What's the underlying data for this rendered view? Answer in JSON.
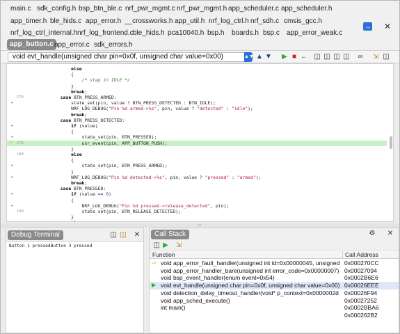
{
  "tabs": {
    "row1": [
      "main.c",
      "sdk_config.h",
      "bsp_btn_ble.c",
      "nrf_pwr_mgmt.c",
      "nrf_pwr_mgmt.h",
      "app_scheduler.c",
      "app_scheduler.h"
    ],
    "row2": [
      "app_timer.h",
      "ble_hids.c",
      "app_error.h",
      "__crossworks.h",
      "app_util.h",
      "nrf_log_ctrl.h",
      "nrf_sdh.c",
      "cmsis_gcc.h"
    ],
    "row3": [
      "nrf_log_ctrl_internal.h",
      "nrf_log_frontend.c",
      "ble_hids.h",
      "pca10040.h",
      "bsp.h",
      "boards.h",
      "bsp.c",
      "app_error_weak.c"
    ],
    "row4": [
      "app_button.c",
      "app_error.c",
      "sdk_errors.h"
    ],
    "active": "app_button.c",
    "nav_icon": "right-arrow-icon",
    "close_icon": "close-icon"
  },
  "function_selector": {
    "value": "void evt_handle(unsigned char pin=0x0f, unsigned char value=0x00)"
  },
  "editor": {
    "lines": [
      {
        "num": "",
        "mark": "",
        "html": "            <span class=\"kw\">else</span>"
      },
      {
        "num": "",
        "mark": "",
        "html": "            {"
      },
      {
        "num": "",
        "mark": "",
        "html": "                <span class=\"cmt\">/* stay in IDLE */</span>"
      },
      {
        "num": "",
        "mark": "",
        "html": "            }"
      },
      {
        "num": "",
        "mark": "",
        "html": "            <span class=\"kw\">break</span>;"
      },
      {
        "num": "170",
        "mark": "",
        "html": "        <span class=\"kw\">case</span> BTN_PRESS_ARMED:"
      },
      {
        "num": "",
        "mark": "bp",
        "html": "            state_set(pin, value ? BTN_PRESS_DETECTED : BTN_IDLE);"
      },
      {
        "num": "",
        "mark": "",
        "html": "            NRF_LOG_DEBUG(<span class=\"str\">\"Pin %d armed->%s\"</span>, pin, value ? <span class=\"str\">\"detected\"</span> : <span class=\"str\">\"idle\"</span>);"
      },
      {
        "num": "",
        "mark": "",
        "html": "            <span class=\"kw\">break</span>;"
      },
      {
        "num": "",
        "mark": "",
        "html": "        <span class=\"kw\">case</span> BTN_PRESS_DETECTED:"
      },
      {
        "num": "",
        "mark": "bp",
        "html": "            <span class=\"kw\">if</span> (value)"
      },
      {
        "num": "",
        "mark": "",
        "html": "            {"
      },
      {
        "num": "",
        "mark": "bp",
        "html": "                state_set(pin, BTN_PRESSED);"
      },
      {
        "num": "178",
        "mark": "cur",
        "hl": true,
        "html": "                usr_event(pin, APP_BUTTON_PUSH);"
      },
      {
        "num": "",
        "mark": "",
        "html": "            }"
      },
      {
        "num": "180",
        "mark": "",
        "html": "            <span class=\"kw\">else</span>"
      },
      {
        "num": "",
        "mark": "",
        "html": "            {"
      },
      {
        "num": "",
        "mark": "bp",
        "html": "                state_set(pin, BTN_PRESS_ARMED);"
      },
      {
        "num": "",
        "mark": "",
        "html": "            }"
      },
      {
        "num": "",
        "mark": "bp",
        "html": "            NRF_LOG_DEBUG(<span class=\"str\">\"Pin %d detected->%s\"</span>, pin, value ? <span class=\"str\">\"pressed\"</span> : <span class=\"str\">\"armed\"</span>);"
      },
      {
        "num": "",
        "mark": "",
        "html": "            <span class=\"kw\">break</span>;"
      },
      {
        "num": "",
        "mark": "",
        "html": "        <span class=\"kw\">case</span> BTN_PRESSED:"
      },
      {
        "num": "",
        "mark": "bp",
        "html": "            <span class=\"kw\">if</span> (value == <span class=\"num\">0</span>)"
      },
      {
        "num": "",
        "mark": "",
        "html": "            {"
      },
      {
        "num": "",
        "mark": "bp",
        "html": "                NRF_LOG_DEBUG(<span class=\"str\">\"Pin %d pressed->release_detected\"</span>, pin);"
      },
      {
        "num": "190",
        "mark": "",
        "html": "                state_set(pin, BTN_RELEASE_DETECTED);"
      },
      {
        "num": "",
        "mark": "",
        "html": "            }"
      },
      {
        "num": "",
        "mark": "",
        "html": "            <span class=\"kw\">else</span>"
      }
    ]
  },
  "debug_terminal": {
    "title": "Debug Terminal",
    "output": "Button 1 pressedButton 3 pressed"
  },
  "call_stack": {
    "title": "Call Stack",
    "col_function": "Function",
    "col_address": "Call Address",
    "rows": [
      {
        "func": "void app_error_fault_handler(unsigned int id=0x00000045, unsigned",
        "addr": "0x000270CC",
        "mark": "arrow"
      },
      {
        "func": "void app_error_handler_bare(unsigned int error_code=0x00000007)",
        "addr": "0x00027094",
        "mark": ""
      },
      {
        "func": "void bsp_event_handler(enum event=0x54)",
        "addr": "0x0002B6E6",
        "mark": ""
      },
      {
        "func": "void evt_handle(unsigned char pin=0x0f, unsigned char value=0x00)",
        "addr": "0x00026EEE",
        "mark": "current"
      },
      {
        "func": "void detection_delay_timeout_handler(void* p_context=0x0000002d",
        "addr": "0x00026F94",
        "mark": ""
      },
      {
        "func": "void app_sched_execute()",
        "addr": "0x00027252",
        "mark": ""
      },
      {
        "func": "int main()",
        "addr": "0x0002BBA6",
        "mark": ""
      },
      {
        "func": "",
        "addr": "0x000262B2",
        "mark": ""
      }
    ]
  }
}
